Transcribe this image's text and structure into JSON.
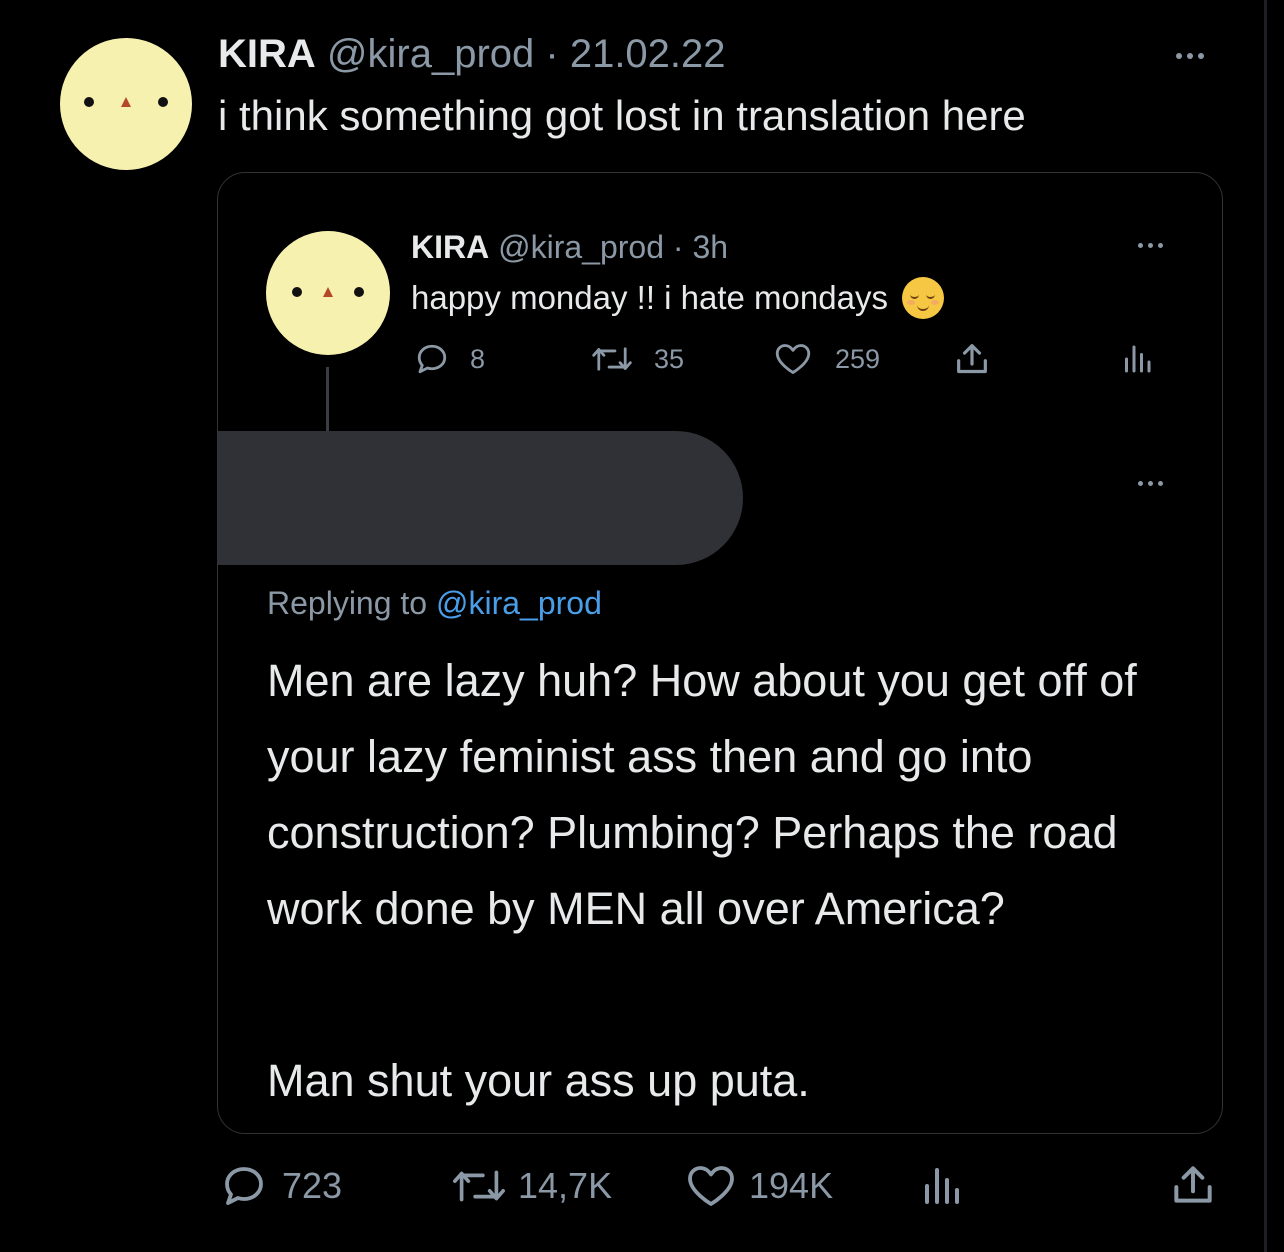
{
  "outer": {
    "name": "KIRA",
    "handle": "@kira_prod",
    "sep": " · ",
    "date": "21.02.22",
    "text": "i think something got lost in translation here",
    "stats": {
      "replies": "723",
      "retweets": "14,7K",
      "likes": "194K"
    }
  },
  "quoted": {
    "name": "KIRA",
    "handle": "@kira_prod",
    "sep": " · ",
    "time": "3h",
    "text": "happy monday !! i hate mondays",
    "emoji": "😌",
    "stats": {
      "replies": "8",
      "retweets": "35",
      "likes": "259"
    }
  },
  "reply": {
    "replying_prefix": "Replying to ",
    "replying_handle": "@kira_prod",
    "paragraph1": "Men are lazy huh? How about you get off of your lazy feminist ass then and go into construction? Plumbing? Perhaps the road work done by MEN all over America?",
    "paragraph2": "Man shut your ass up puta."
  },
  "colors": {
    "background": "#000000",
    "avatar": "#f7f1b0",
    "link": "#4a9ee8",
    "muted": "#8b98a5",
    "redaction": "#2f3136"
  },
  "icons": [
    "more-icon",
    "reply-icon",
    "retweet-icon",
    "like-icon",
    "share-icon",
    "analytics-icon"
  ]
}
